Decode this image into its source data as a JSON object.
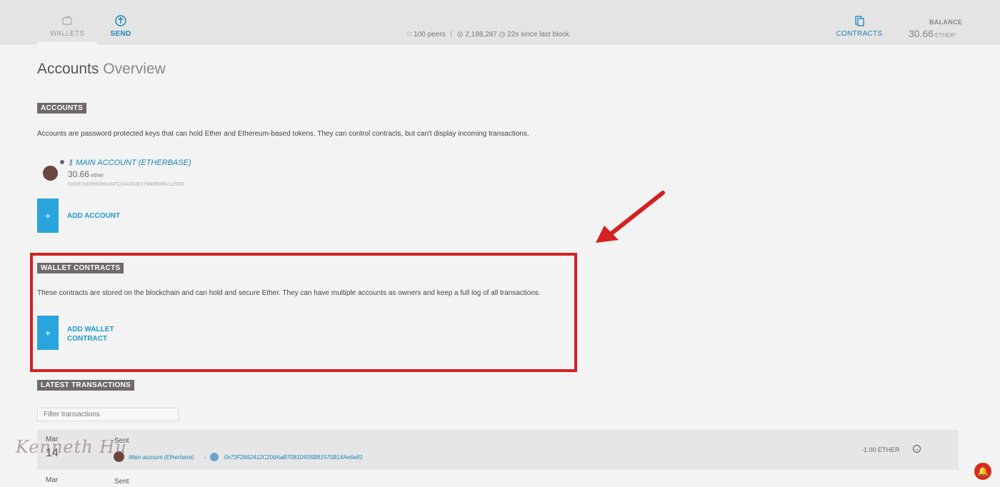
{
  "header": {
    "nav": {
      "wallets": "WALLETS",
      "send": "SEND",
      "contracts": "CONTRACTS"
    },
    "status": {
      "peers": "100 peers",
      "block": "2,188,287",
      "since_block": "22s since last block"
    },
    "balance": {
      "label": "BALANCE",
      "value": "30.66",
      "unit": "ETHER*"
    }
  },
  "page": {
    "title_bold": "Accounts",
    "title_light": "Overview"
  },
  "accounts": {
    "tag": "ACCOUNTS",
    "description": "Accounts are password protected keys that can hold Ether and Ethereum-based tokens. They can control contracts, but can't display incoming transactions.",
    "main_account": {
      "name": "MAIN ACCOUNT (ETHERBASE)",
      "balance": "30.66",
      "unit": "ether",
      "address": "0xf2d15d1f062b6cfAFC034300E57980BB6Ec120D9"
    },
    "add_label": "ADD ACCOUNT",
    "plus": "+"
  },
  "wallet_contracts": {
    "tag": "WALLET CONTRACTS",
    "description": "These contracts are stored on the blockchain and can hold and secure Ether. They can have multiple accounts as owners and keep a full log of all transactions.",
    "add_label_line1": "ADD WALLET",
    "add_label_line2": "CONTRACT",
    "plus": "+"
  },
  "transactions": {
    "tag": "LATEST TRANSACTIONS",
    "filter_placeholder": "Filter transactions",
    "rows": [
      {
        "month": "Mar",
        "day": "14",
        "type": "Sent",
        "from": "Main account (Etherbase)",
        "to": "0x73F2662412C20dAaB7081D935B81575B14Ae6e81",
        "amount": "-1.00 ETHER"
      },
      {
        "month": "Mar",
        "type": "Sent"
      }
    ]
  },
  "watermark": "Kenneth Hu",
  "colors": {
    "accent": "#1a84b8",
    "button": "#2aa4dd",
    "highlight": "#d42121",
    "tag_bg": "#716a6a"
  }
}
